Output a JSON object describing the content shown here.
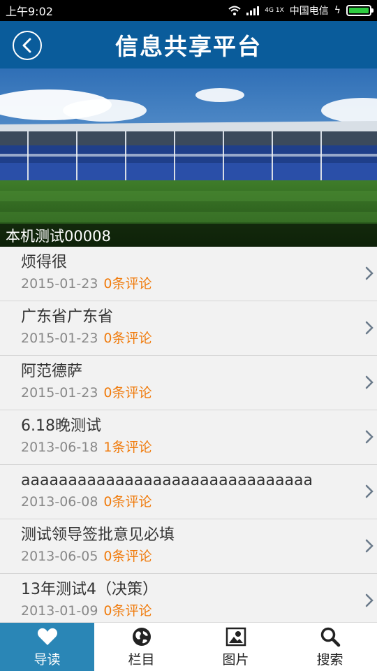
{
  "status_bar": {
    "time": "上午9:02",
    "network": "4G 1X",
    "carrier": "中国电信"
  },
  "header": {
    "title": "信息共享平台"
  },
  "banner": {
    "caption": "本机测试00008"
  },
  "articles": [
    {
      "title": "烦得很",
      "date": "2015-01-23",
      "comments": "0条评论"
    },
    {
      "title": "广东省广东省",
      "date": "2015-01-23",
      "comments": "0条评论"
    },
    {
      "title": "阿范德萨",
      "date": "2015-01-23",
      "comments": "0条评论"
    },
    {
      "title": "6.18晚测试",
      "date": "2013-06-18",
      "comments": "1条评论"
    },
    {
      "title": "aaaaaaaaaaaaaaaaaaaaaaaaaaaaaaa",
      "date": "2013-06-08",
      "comments": "0条评论"
    },
    {
      "title": "测试领导签批意见必填",
      "date": "2013-06-05",
      "comments": "0条评论"
    },
    {
      "title": "13年测试4（决策）",
      "date": "2013-01-09",
      "comments": "0条评论"
    }
  ],
  "tabs": [
    {
      "label": "导读",
      "icon": "heart-icon",
      "active": true
    },
    {
      "label": "栏目",
      "icon": "globe-icon",
      "active": false
    },
    {
      "label": "图片",
      "icon": "picture-icon",
      "active": false
    },
    {
      "label": "搜索",
      "icon": "search-icon",
      "active": false
    }
  ],
  "colors": {
    "header": "#0a5c9b",
    "accent_tab": "#2a86b6",
    "comment_count": "#f07b0c"
  }
}
